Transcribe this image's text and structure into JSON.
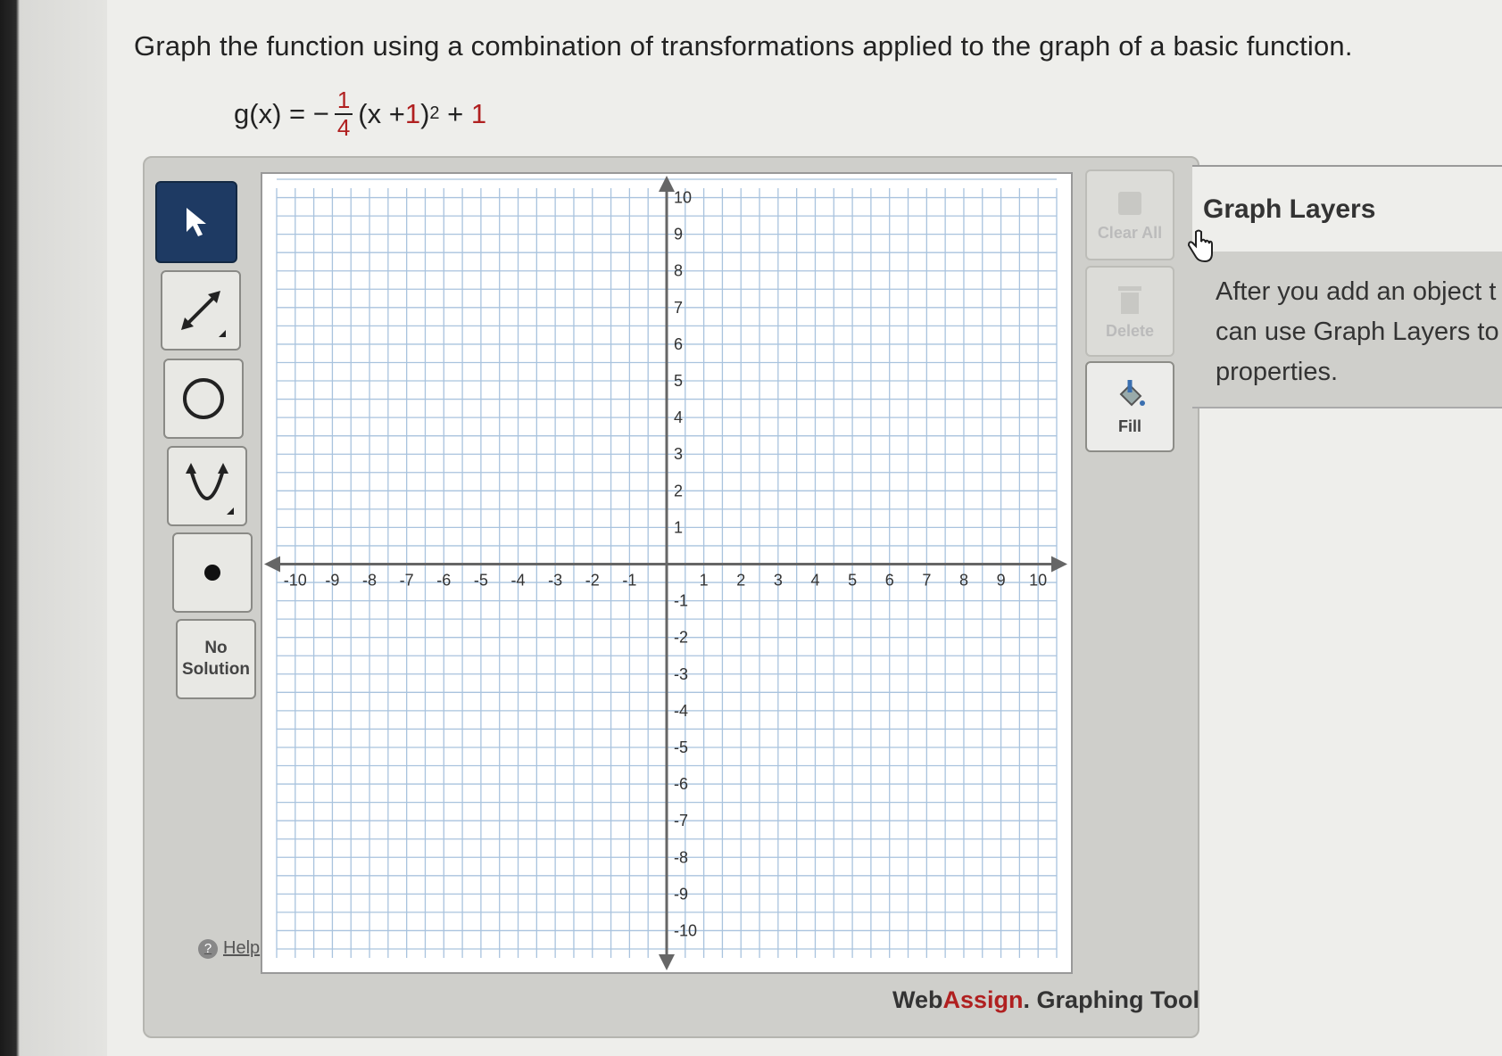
{
  "question": {
    "prompt": "Graph the function using a combination of transformations applied to the graph of a basic function.",
    "formula_lhs": "g(x) = −",
    "formula_num": "1",
    "formula_den": "4",
    "formula_mid": "(x + ",
    "formula_h": "1",
    "formula_close": ")",
    "formula_exp": "2",
    "formula_plus": " + ",
    "formula_k": "1"
  },
  "toolbar": {
    "select_icon": "arrow-pointer-icon",
    "line_icon": "line-segment-icon",
    "circle_icon": "circle-icon",
    "parabola_icon": "parabola-icon",
    "point_icon": "point-icon",
    "no_solution_line1": "No",
    "no_solution_line2": "Solution",
    "help_label": "Help"
  },
  "graph": {
    "x_min": -10,
    "x_max": 10,
    "y_min": -10,
    "y_max": 10,
    "grid_step": 0.5,
    "x_ticks": [
      "-10",
      "-9",
      "-8",
      "-7",
      "-6",
      "-5",
      "-4",
      "-3",
      "-2",
      "-1",
      "1",
      "2",
      "3",
      "4",
      "5",
      "6",
      "7",
      "8",
      "9",
      "10"
    ],
    "y_ticks": [
      "10",
      "9",
      "8",
      "7",
      "6",
      "5",
      "4",
      "3",
      "2",
      "1",
      "-1",
      "-2",
      "-3",
      "-4",
      "-5",
      "-6",
      "-7",
      "-8",
      "-9",
      "-10"
    ]
  },
  "right_tools": {
    "clear_all": "Clear All",
    "delete": "Delete",
    "fill": "Fill"
  },
  "layers": {
    "title": "Graph Layers",
    "line1": "After you add an object t",
    "line2": "can use Graph Layers to",
    "line3": "properties."
  },
  "brand": {
    "web": "Web",
    "assign": "Assign",
    "rest": ". Graphing Tool"
  },
  "colors": {
    "accent_red": "#b02020",
    "active_tool": "#1e3a63",
    "grid": "#a9c3de"
  }
}
